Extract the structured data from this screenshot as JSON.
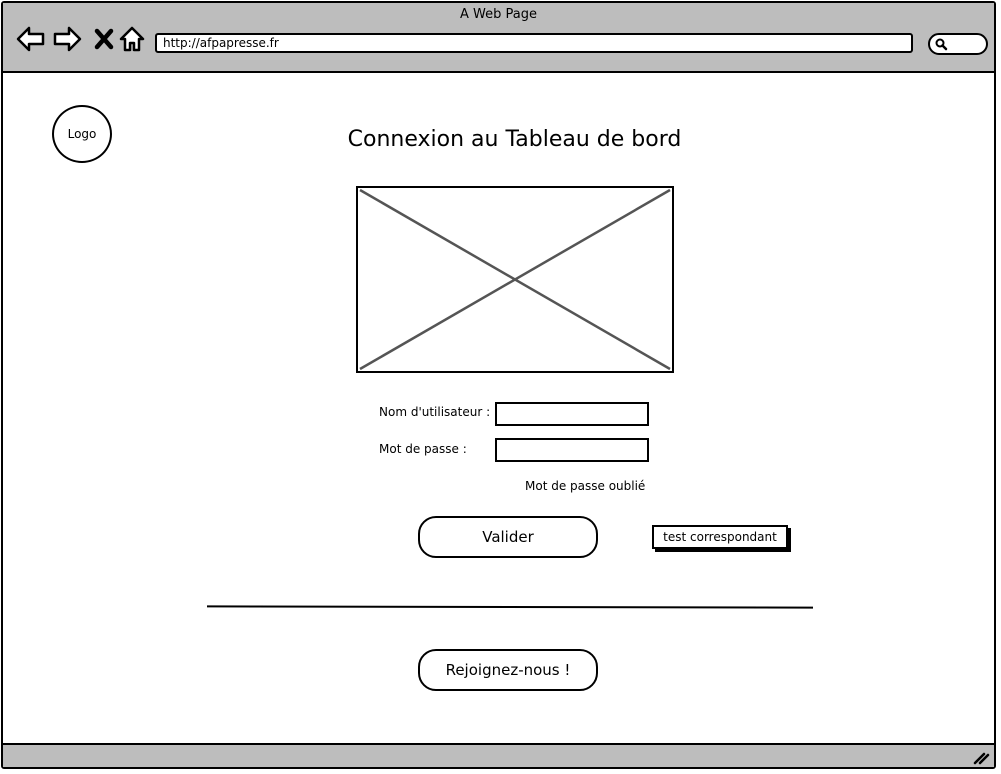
{
  "window": {
    "title": "A Web Page"
  },
  "toolbar": {
    "icons": [
      "back-arrow-icon",
      "forward-arrow-icon",
      "close-x-icon",
      "home-icon"
    ],
    "url": "http://afpapresse.fr",
    "search_icon": "search-icon"
  },
  "page": {
    "logo_label": "Logo",
    "title": "Connexion au Tableau de bord",
    "image_placeholder_icon": "image-placeholder-cross",
    "username_label": "Nom d'utilisateur :",
    "username_value": "",
    "password_label": "Mot de passe :",
    "password_value": "",
    "forgot_password_label": "Mot de passe oublié",
    "submit_label": "Valider",
    "test_button_label": "test correspondant",
    "join_label": "Rejoignez-nous !"
  },
  "colors": {
    "chrome": "#bdbdbd",
    "stroke": "#000000",
    "placeholder_lines": "#555555"
  }
}
